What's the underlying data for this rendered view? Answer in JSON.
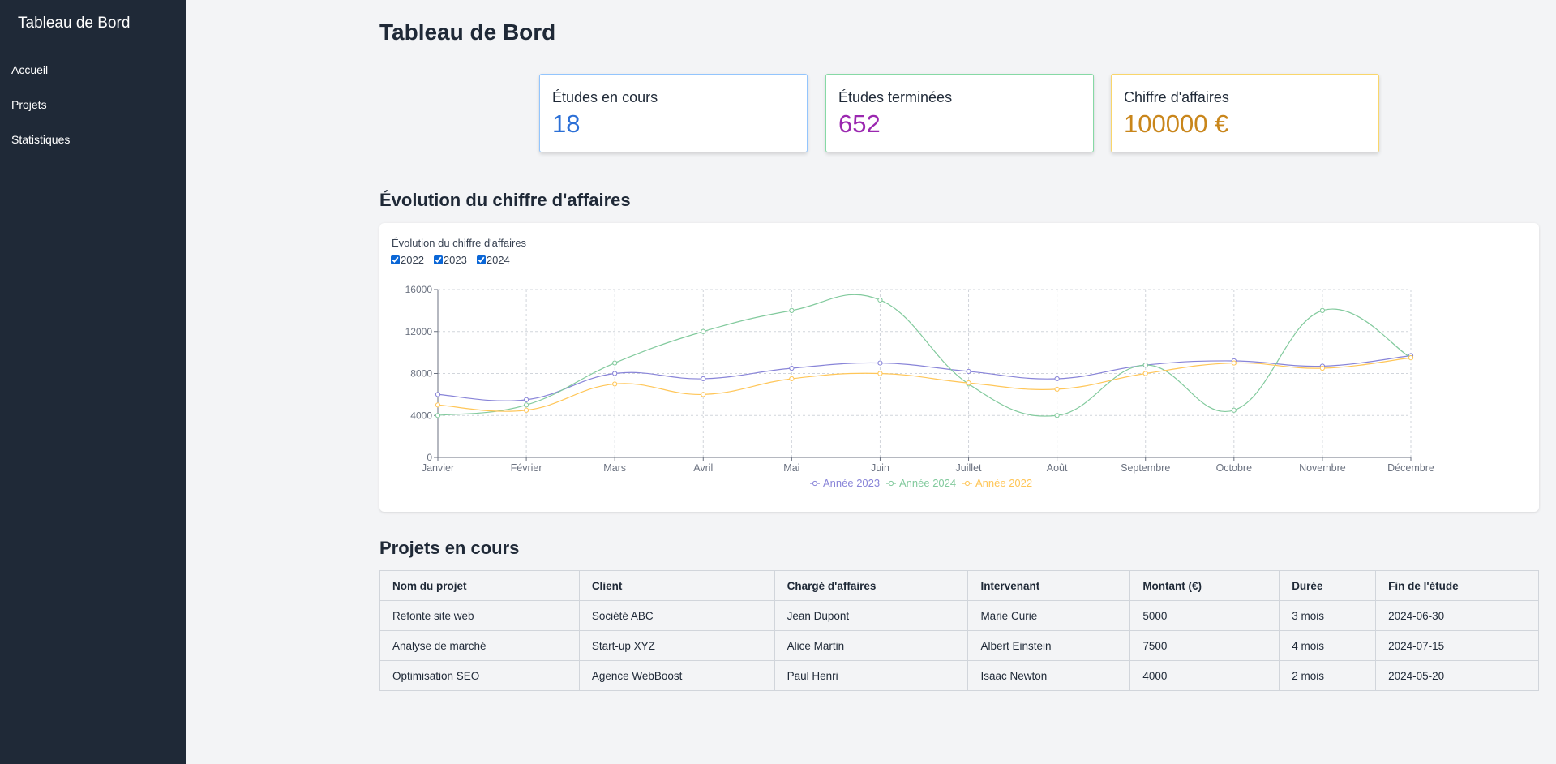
{
  "sidebar": {
    "brand": "Tableau de Bord",
    "items": [
      {
        "label": "Accueil"
      },
      {
        "label": "Projets"
      },
      {
        "label": "Statistiques"
      }
    ]
  },
  "main": {
    "title": "Tableau de Bord",
    "cards": [
      {
        "label": "Études en cours",
        "value": "18",
        "color": "#2b6fd6",
        "border": "#93c5fd"
      },
      {
        "label": "Études terminées",
        "value": "652",
        "color": "#9b27b0",
        "border": "#86d9a5"
      },
      {
        "label": "Chiffre d'affaires",
        "value": "100000 €",
        "color": "#c9861b",
        "border": "#f9d66b"
      }
    ],
    "chart_section_title": "Évolution du chiffre d'affaires",
    "projects_section_title": "Projets en cours"
  },
  "chart_data": {
    "type": "line",
    "title": "Évolution du chiffre d'affaires",
    "toggles": [
      {
        "label": "2022",
        "checked": true
      },
      {
        "label": "2023",
        "checked": true
      },
      {
        "label": "2024",
        "checked": true
      }
    ],
    "categories": [
      "Janvier",
      "Février",
      "Mars",
      "Avril",
      "Mai",
      "Juin",
      "Juillet",
      "Août",
      "Septembre",
      "Octobre",
      "Novembre",
      "Décembre"
    ],
    "series": [
      {
        "name": "Année 2023",
        "color": "#8884d8",
        "values": [
          6000,
          5500,
          8000,
          7500,
          8500,
          9000,
          8200,
          7500,
          8800,
          9200,
          8700,
          9700
        ]
      },
      {
        "name": "Année 2024",
        "color": "#82ca9d",
        "values": [
          4000,
          5000,
          9000,
          12000,
          14000,
          15000,
          7000,
          4000,
          8800,
          4500,
          14000,
          9500
        ]
      },
      {
        "name": "Année 2022",
        "color": "#ffc658",
        "values": [
          5000,
          4500,
          7000,
          6000,
          7500,
          8000,
          7100,
          6500,
          8000,
          9000,
          8500,
          9500
        ]
      }
    ],
    "ylim": [
      0,
      16000
    ],
    "yticks": [
      "0",
      "4000",
      "8000",
      "12000",
      "16000"
    ],
    "grid": true,
    "legend_position": "bottom"
  },
  "table": {
    "headers": [
      "Nom du projet",
      "Client",
      "Chargé d'affaires",
      "Intervenant",
      "Montant (€)",
      "Durée",
      "Fin de l'étude"
    ],
    "rows": [
      [
        "Refonte site web",
        "Société ABC",
        "Jean Dupont",
        "Marie Curie",
        "5000",
        "3 mois",
        "2024-06-30"
      ],
      [
        "Analyse de marché",
        "Start-up XYZ",
        "Alice Martin",
        "Albert Einstein",
        "7500",
        "4 mois",
        "2024-07-15"
      ],
      [
        "Optimisation SEO",
        "Agence WebBoost",
        "Paul Henri",
        "Isaac Newton",
        "4000",
        "2 mois",
        "2024-05-20"
      ]
    ]
  }
}
